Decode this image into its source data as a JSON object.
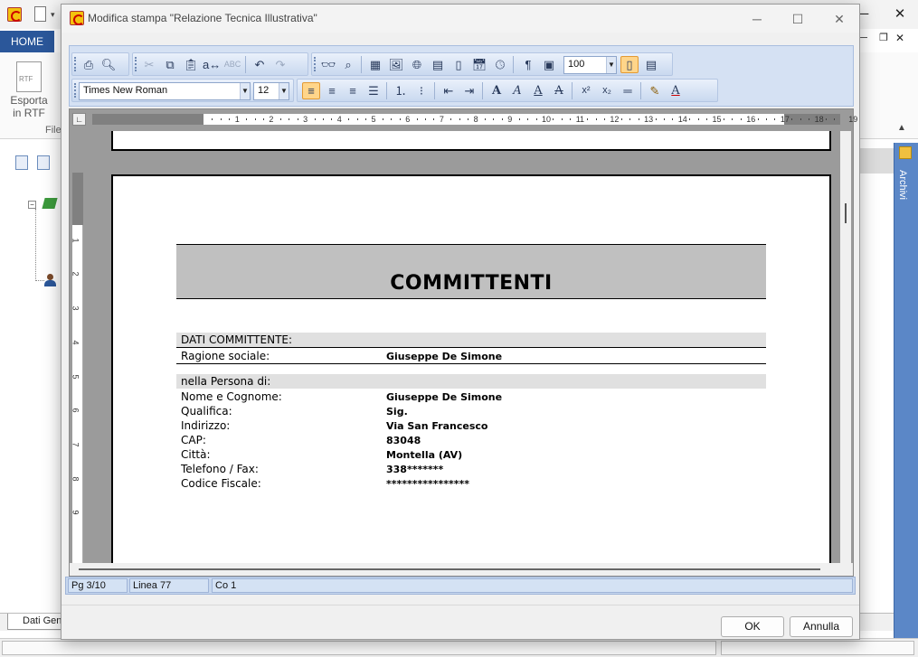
{
  "app": {
    "home_tab": "HOME",
    "export_rtf_label": "Esporta in RTF",
    "file_group_label": "File",
    "archivi_label": "Archivi",
    "bottom_tab": "Dati Gen"
  },
  "dialog": {
    "title": "Modifica stampa  \"Relazione Tecnica Illustrativa\"",
    "ok_label": "OK",
    "cancel_label": "Annulla"
  },
  "toolbar": {
    "zoom_value": "100",
    "font_name": "Times New Roman",
    "font_size": "12"
  },
  "ruler": {
    "h_numbers": [
      "1",
      "2",
      "3",
      "4",
      "5",
      "6",
      "7",
      "8",
      "9",
      "10",
      "11",
      "12",
      "13",
      "14",
      "15",
      "16",
      "17",
      "18",
      "19"
    ],
    "v_numbers": [
      "1",
      "2",
      "3",
      "4",
      "5",
      "6",
      "7",
      "8",
      "9"
    ]
  },
  "document": {
    "section_title": "COMMITTENTI",
    "band1": "DATI COMMITTENTE:",
    "ragione_label": "Ragione sociale:",
    "ragione_value": "Giuseppe De Simone",
    "band2": "nella Persona di:",
    "rows": [
      {
        "label": "Nome e Cognome:",
        "value": "Giuseppe De Simone"
      },
      {
        "label": "Qualifica:",
        "value": "Sig."
      },
      {
        "label": "Indirizzo:",
        "value": "Via San Francesco"
      },
      {
        "label": "CAP:",
        "value": "83048"
      },
      {
        "label": "Città:",
        "value": "Montella (AV)"
      },
      {
        "label": "Telefono / Fax:",
        "value": "338*******"
      },
      {
        "label": "Codice Fiscale:",
        "value": "****************"
      }
    ]
  },
  "status": {
    "page": "Pg 3/10",
    "line": "Linea 77",
    "col": "Co 1"
  }
}
